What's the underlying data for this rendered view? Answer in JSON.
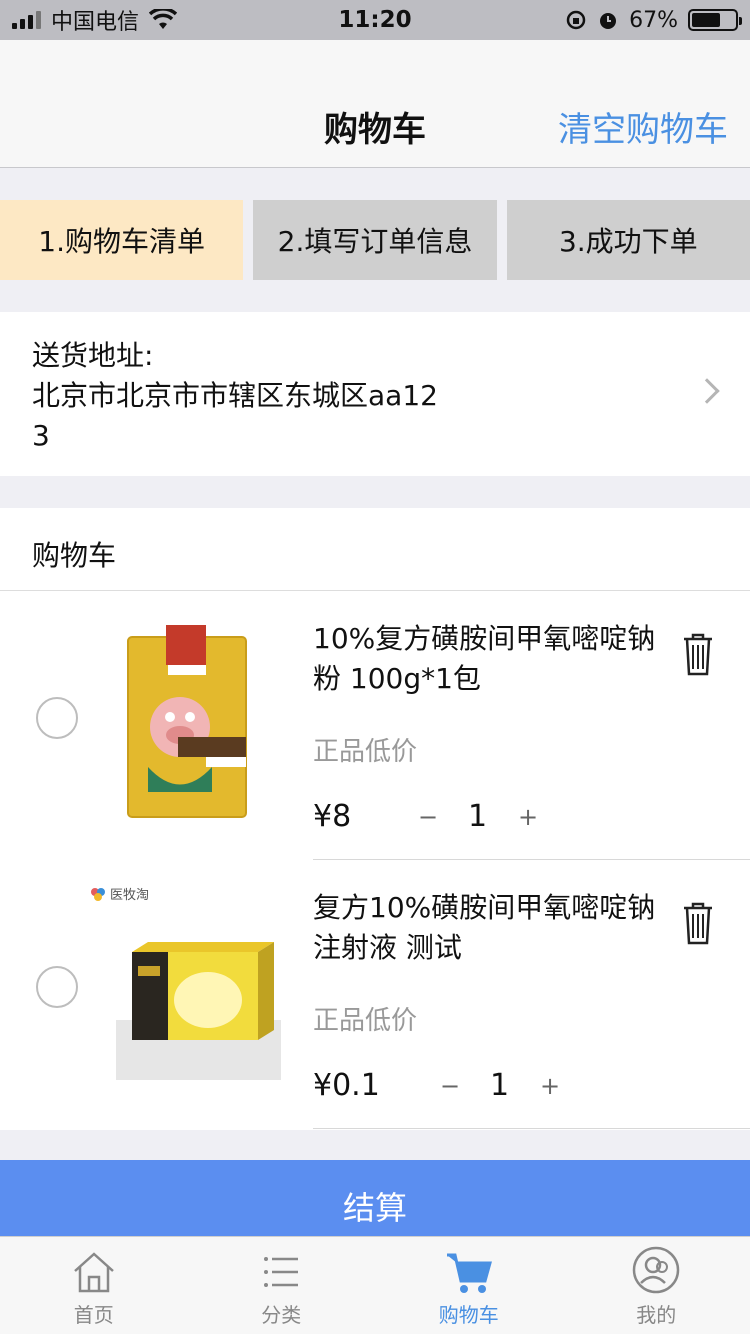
{
  "status_bar": {
    "carrier": "中国电信",
    "time": "11:20",
    "battery": "67%",
    "battery_level": 0.67
  },
  "nav": {
    "title": "购物车",
    "action": "清空购物车"
  },
  "steps": [
    {
      "label": "1.购物车清单",
      "active": true
    },
    {
      "label": "2.填写订单信息",
      "active": false
    },
    {
      "label": "3.成功下单",
      "active": false
    }
  ],
  "address": {
    "label": "送货地址:",
    "value": "北京市北京市市辖区东城区aa123"
  },
  "cart": {
    "header": "购物车",
    "items": [
      {
        "title": "10%复方磺胺间甲氧嘧啶钠粉 100g*1包",
        "subtitle": "正品低价",
        "price": "¥8",
        "quantity": "1",
        "minus": "−",
        "plus": "+",
        "image_icon": "product-pouch-image"
      },
      {
        "title": "复方10%磺胺间甲氧嘧啶钠注射液 测试",
        "subtitle": "正品低价",
        "price": "¥0.1",
        "quantity": "1",
        "minus": "−",
        "plus": "+",
        "image_icon": "product-box-image",
        "image_brand": "医牧淘"
      }
    ]
  },
  "checkout": {
    "label": "结算"
  },
  "tabs": [
    {
      "label": "首页",
      "icon": "home-icon",
      "active": false
    },
    {
      "label": "分类",
      "icon": "list-icon",
      "active": false
    },
    {
      "label": "购物车",
      "icon": "cart-icon",
      "active": true
    },
    {
      "label": "我的",
      "icon": "user-icon",
      "active": false
    }
  ],
  "colors": {
    "accent": "#4a90e2",
    "checkout": "#5b8ef0",
    "step_active": "#fde8c4",
    "step_inactive": "#cfcfcf"
  }
}
